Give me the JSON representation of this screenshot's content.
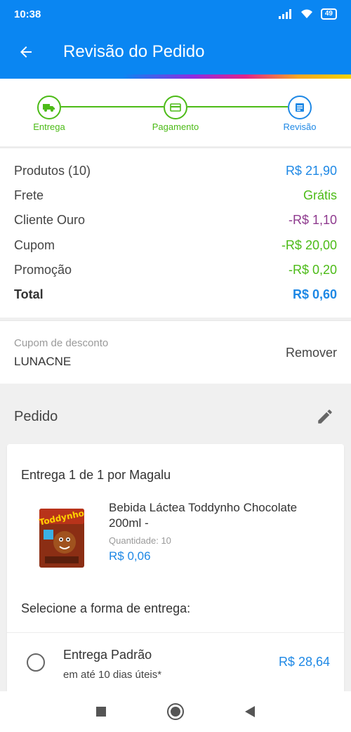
{
  "status_bar": {
    "time": "10:38",
    "battery": "49"
  },
  "header": {
    "title": "Revisão do Pedido"
  },
  "stepper": {
    "steps": [
      {
        "label": "Entrega"
      },
      {
        "label": "Pagamento"
      },
      {
        "label": "Revisão"
      }
    ],
    "colors": {
      "done": "#4cbb17",
      "current": "#1e88e5"
    }
  },
  "summary": {
    "rows": [
      {
        "label": "Produtos (10)",
        "value": "R$ 21,90",
        "color": "#1e88e5"
      },
      {
        "label": "Frete",
        "value": "Grátis",
        "color": "#4cbb17"
      },
      {
        "label": "Cliente Ouro",
        "value": "-R$ 1,10",
        "color": "#8e3a8e"
      },
      {
        "label": "Cupom",
        "value": "-R$ 20,00",
        "color": "#4cbb17"
      },
      {
        "label": "Promoção",
        "value": "-R$ 0,20",
        "color": "#4cbb17"
      },
      {
        "label": "Total",
        "value": "R$ 0,60",
        "color": "#1e88e5"
      }
    ]
  },
  "coupon": {
    "caption": "Cupom de desconto",
    "code": "LUNACNE",
    "remove_label": "Remover"
  },
  "order": {
    "title": "Pedido",
    "delivery_title": "Entrega 1 de 1 por Magalu",
    "product": {
      "name": "Bebida Láctea Toddynho Chocolate 200ml -",
      "quantity_label": "Quantidade:  10",
      "price": "R$ 0,06"
    },
    "select_label": "Selecione a forma de entrega:",
    "shipping_option": {
      "name": "Entrega Padrão",
      "eta": "em até 10 dias úteis*",
      "price": "R$ 28,64"
    }
  },
  "icons": {
    "back": "arrow-left-icon",
    "edit": "pencil-icon",
    "step_delivery": "truck-icon",
    "step_payment": "credit-card-icon",
    "step_review": "document-icon",
    "nav": [
      "square-recents-icon",
      "circle-home-icon",
      "triangle-back-icon"
    ]
  }
}
